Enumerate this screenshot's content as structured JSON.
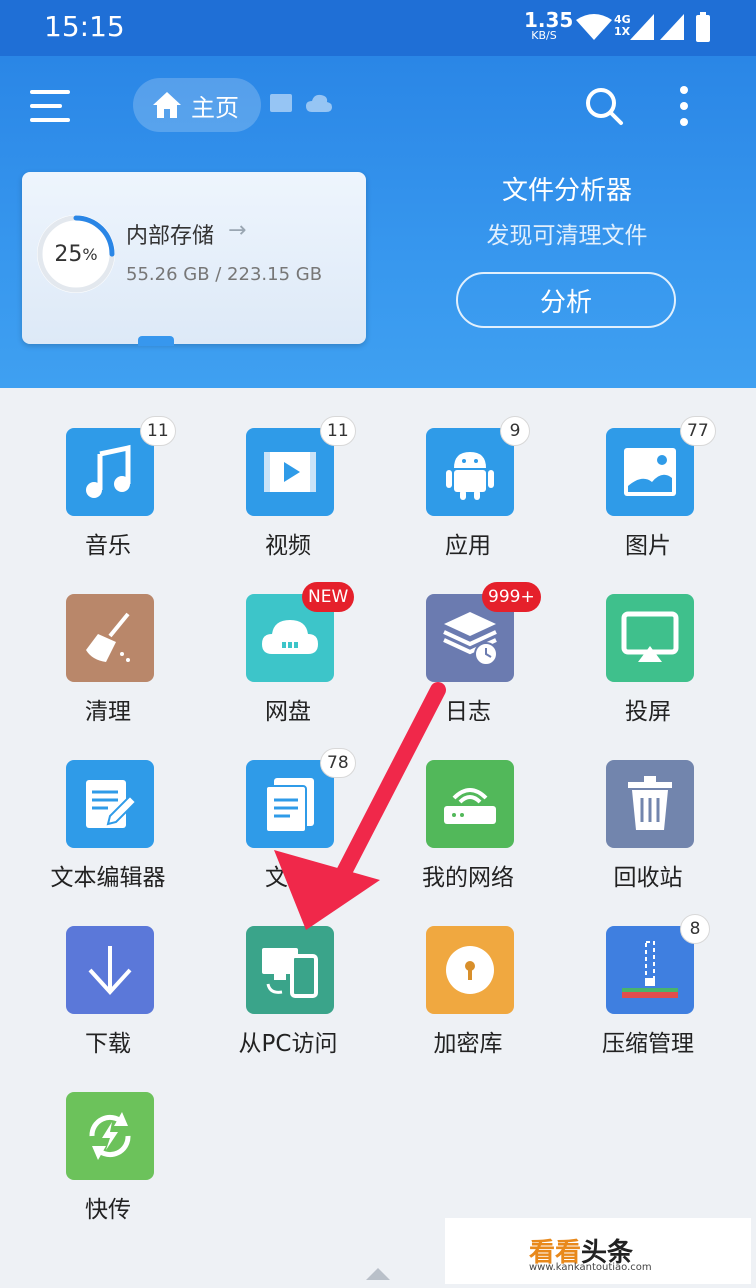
{
  "status_bar": {
    "time": "15:15",
    "speed_value": "1.35",
    "speed_unit": "KB/S",
    "network_top": "4G",
    "network_bottom": "1X"
  },
  "toolbar": {
    "home_label": "主页"
  },
  "storage": {
    "percent": "25",
    "percent_sign": "%",
    "name": "内部存储",
    "used_total": "55.26 GB / 223.15 GB",
    "used_fraction": 0.25
  },
  "analyzer": {
    "title": "文件分析器",
    "subtitle": "发现可清理文件",
    "button": "分析"
  },
  "apps": [
    {
      "label": "音乐",
      "badge": "11",
      "icon": "music-icon",
      "color": "#2f9be8"
    },
    {
      "label": "视频",
      "badge": "11",
      "icon": "video-icon",
      "color": "#2f9be8"
    },
    {
      "label": "应用",
      "badge": "9",
      "icon": "android-icon",
      "color": "#2f9be8"
    },
    {
      "label": "图片",
      "badge": "77",
      "icon": "image-icon",
      "color": "#2f9be8"
    },
    {
      "label": "清理",
      "badge": "",
      "icon": "broom-icon",
      "color": "#b9876a"
    },
    {
      "label": "网盘",
      "badge": "NEW",
      "icon": "cloud-icon",
      "color": "#3dc5c9"
    },
    {
      "label": "日志",
      "badge": "999+",
      "icon": "log-icon",
      "color": "#6b7bb0"
    },
    {
      "label": "投屏",
      "badge": "",
      "icon": "screen-cast-icon",
      "color": "#3fc08c"
    },
    {
      "label": "文本编辑器",
      "badge": "",
      "icon": "text-editor-icon",
      "color": "#2f9be8"
    },
    {
      "label": "文档",
      "badge": "78",
      "icon": "document-icon",
      "color": "#2f9be8"
    },
    {
      "label": "我的网络",
      "badge": "",
      "icon": "router-icon",
      "color": "#52b85a"
    },
    {
      "label": "回收站",
      "badge": "",
      "icon": "trash-icon",
      "color": "#7285ad"
    },
    {
      "label": "下载",
      "badge": "",
      "icon": "download-icon",
      "color": "#5b78d9"
    },
    {
      "label": "从PC访问",
      "badge": "",
      "icon": "pc-access-icon",
      "color": "#3aa48a"
    },
    {
      "label": "加密库",
      "badge": "",
      "icon": "lock-icon",
      "color": "#f0a840"
    },
    {
      "label": "压缩管理",
      "badge": "8",
      "icon": "zip-icon",
      "color": "#3f7fe0"
    },
    {
      "label": "快传",
      "badge": "",
      "icon": "quick-transfer-icon",
      "color": "#6cc25b"
    }
  ],
  "watermark": {
    "brand": "看看",
    "brand_rest": "头条",
    "url": "www.kankantoutiao.com"
  },
  "colors": {
    "accent": "#2a86e6",
    "annotation_arrow": "#f0284a"
  }
}
